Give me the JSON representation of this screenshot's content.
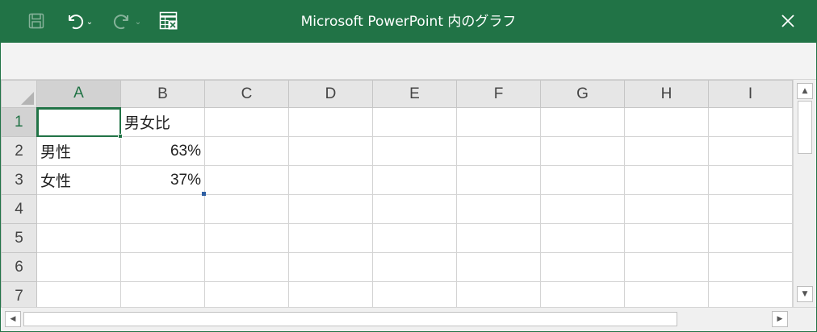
{
  "window": {
    "title": "Microsoft PowerPoint 内のグラフ"
  },
  "toolbar": {
    "save_icon": "save-icon",
    "undo_icon": "undo-icon",
    "redo_icon": "redo-icon",
    "edit_data_icon": "edit-data-in-excel-icon",
    "close_icon": "close-icon",
    "dropdown_glyph": "⌄",
    "close_glyph": "✕"
  },
  "sheet": {
    "columns": [
      "A",
      "B",
      "C",
      "D",
      "E",
      "F",
      "G",
      "H",
      "I"
    ],
    "rows": [
      {
        "num": "1",
        "cells": [
          "",
          "男女比",
          "",
          "",
          "",
          "",
          "",
          "",
          ""
        ]
      },
      {
        "num": "2",
        "cells": [
          "男性",
          "63%",
          "",
          "",
          "",
          "",
          "",
          "",
          ""
        ]
      },
      {
        "num": "3",
        "cells": [
          "女性",
          "37%",
          "",
          "",
          "",
          "",
          "",
          "",
          ""
        ]
      },
      {
        "num": "4",
        "cells": [
          "",
          "",
          "",
          "",
          "",
          "",
          "",
          "",
          ""
        ]
      },
      {
        "num": "5",
        "cells": [
          "",
          "",
          "",
          "",
          "",
          "",
          "",
          "",
          ""
        ]
      },
      {
        "num": "6",
        "cells": [
          "",
          "",
          "",
          "",
          "",
          "",
          "",
          "",
          ""
        ]
      },
      {
        "num": "7",
        "cells": [
          "",
          "",
          "",
          "",
          "",
          "",
          "",
          "",
          ""
        ]
      }
    ],
    "selected_cell": "A1"
  },
  "scrollbars": {
    "up_glyph": "▲",
    "down_glyph": "▼",
    "left_glyph": "◀",
    "right_glyph": "▶"
  },
  "colors": {
    "accent": "#217346",
    "range_handle": "#2e5fa3"
  }
}
